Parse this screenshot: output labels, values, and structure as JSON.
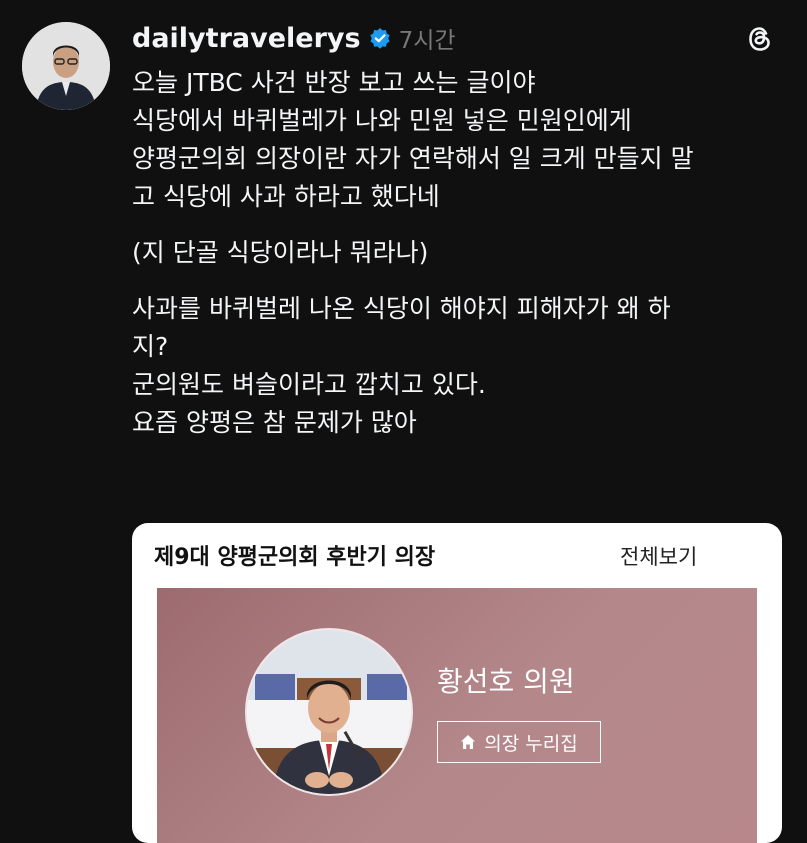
{
  "post": {
    "username": "dailytravelerys",
    "time": "7시간",
    "lines": [
      "오늘 JTBC 사건 반장 보고 쓰는 글이야",
      "식당에서 바퀴벌레가 나와 민원 넣은 민원인에게",
      "양평군의회 의장이란 자가 연락해서 일 크게 만들지 말",
      "고 식당에 사과 하라고 했다네",
      "(지 단골 식당이라나 뭐라나)",
      "사과를 바퀴벌레 나온 식당이 해야지 피해자가 왜 하",
      "지?",
      "군의원도 벼슬이라고 깝치고 있다.",
      "요즘 양평은 참 문제가 많아"
    ]
  },
  "card": {
    "title": "제9대 양평군의회 후반기 의장",
    "more_label": "전체보기",
    "member_name": "황선호 의원",
    "home_label": "의장 누리집"
  },
  "icons": {
    "verified": "verified-badge-icon",
    "threads": "threads-logo-icon",
    "home": "home-icon"
  },
  "colors": {
    "background": "#101010",
    "verified": "#1d9bf0",
    "banner": "#a87a7e"
  }
}
